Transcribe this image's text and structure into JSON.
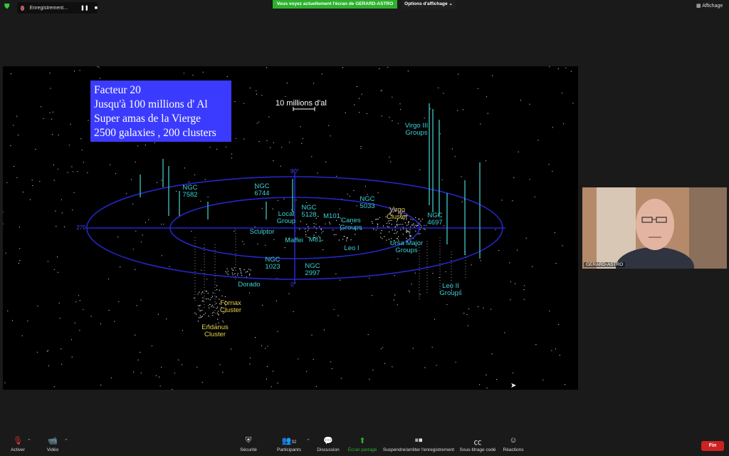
{
  "top": {
    "recording_label": "Enregistrement...",
    "pause_icon": "❚❚",
    "stop_icon": "■",
    "banner": "Vous voyez actuellement l'écran de GERARD-ASTRO",
    "options": "Options d'affichage ⌄",
    "view": "Affichage"
  },
  "slide": {
    "box_lines": [
      "Facteur 20",
      "Jusqu'à 100 millions d' Al",
      "Super amas de la Vierge",
      "2500 galaxies , 200 clusters"
    ],
    "scale": "10 millions d'al",
    "deg90": "90°",
    "deg0": "0°",
    "deg270": "270",
    "labels": {
      "ngc7582": "NGC\n7582",
      "ngc6744": "NGC\n6744",
      "ngc5128": "NGC\n5128",
      "ngc5033": "NGC\n5033",
      "virgo3": "Virgo III\nGroups",
      "virgo": "Virgo\nCluster",
      "ngc4697": "NGC\n4697",
      "local": "Local\nGroup",
      "m101": "M101",
      "canes": "Canes\nGroups",
      "sculptor": "Sculptor",
      "maffei": "Maffei",
      "m81": "M81",
      "leo1": "Leo I",
      "ursa": "Ursa Major\nGroups",
      "ngc1023": "NGC\n1023",
      "ngc2997": "NGC\n2997",
      "dorado": "Dorado",
      "leo2": "Leo II\nGroups",
      "fornax": "Fornax\nCluster",
      "eridanus": "Eridanus\nCluster"
    }
  },
  "camera": {
    "name": "GERARD-ASTRO"
  },
  "bottom": {
    "activer": "Activer",
    "video": "Vidéo",
    "securite": "Sécurité",
    "participants": "Participants",
    "participants_count": "32",
    "discussion": "Discussion",
    "ecran": "Écran partagé",
    "suspendre": "Suspendre/arrêter l'enregistrement",
    "soustitrage": "Sous-titrage codé",
    "reactions": "Réactions",
    "fin": "Fin"
  },
  "colors": {
    "accent_green": "#2db12d",
    "end_red": "#cc2222",
    "label_cyan": "#3cd0d6",
    "label_yellow": "#e6d14a"
  }
}
